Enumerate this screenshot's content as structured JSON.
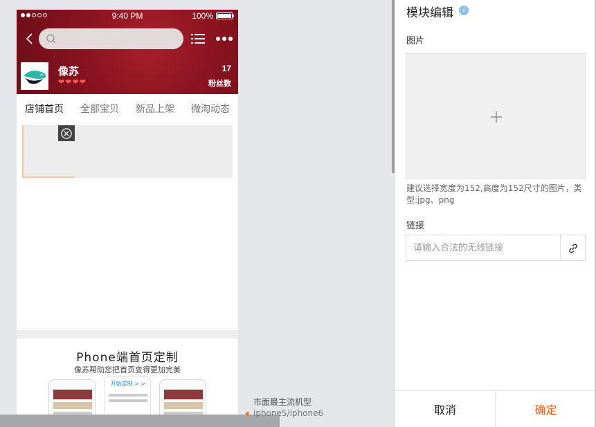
{
  "status_bar": {
    "time": "9:40 PM",
    "battery": "100%"
  },
  "search": {
    "placeholder": ""
  },
  "shop": {
    "name": "像苏",
    "fans_count": "17",
    "fans_label": "粉丝数",
    "hearts": [
      "❤",
      "❤",
      "❤",
      "❤"
    ]
  },
  "tabs": [
    {
      "label": "店铺首页",
      "active": true
    },
    {
      "label": "全部宝贝",
      "active": false
    },
    {
      "label": "新品上架",
      "active": false
    },
    {
      "label": "微淘动态",
      "active": false
    }
  ],
  "promo": {
    "title": "Phone端首页定制",
    "subtitle": "像苏帮助您把首页变得更加完美",
    "cta": "开始定制 > >"
  },
  "notes": {
    "line1": "市面最主流机型",
    "line2": "iphone5/iphone6"
  },
  "panel": {
    "title": "模块编辑",
    "image_label": "图片",
    "hint": "建议选择宽度为152,高度为152尺寸的图片，类型:jpg、png",
    "link_label": "链接",
    "link_placeholder": "请输入合法的无线链接",
    "cancel": "取消",
    "confirm": "确定"
  },
  "colors": {
    "header_red": "#8a1420",
    "accent_orange": "#f05a14",
    "info_blue": "#8fc2ea"
  }
}
